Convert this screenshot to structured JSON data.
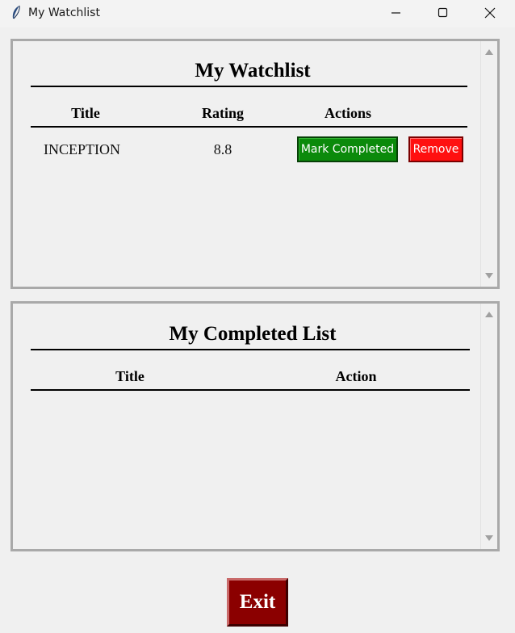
{
  "window": {
    "title": "My Watchlist"
  },
  "watchlist": {
    "heading": "My Watchlist",
    "columns": [
      "Title",
      "Rating",
      "Actions"
    ],
    "rows": [
      {
        "title": "INCEPTION",
        "rating": "8.8",
        "mark_label": "Mark Completed",
        "remove_label": "Remove"
      }
    ]
  },
  "completed": {
    "heading": "My Completed List",
    "columns": [
      "Title",
      "Action"
    ],
    "rows": []
  },
  "exit_label": "Exit",
  "colors": {
    "mark_button": "#0b8a0b",
    "remove_button": "#ff1010",
    "exit_button": "#8b0000"
  }
}
